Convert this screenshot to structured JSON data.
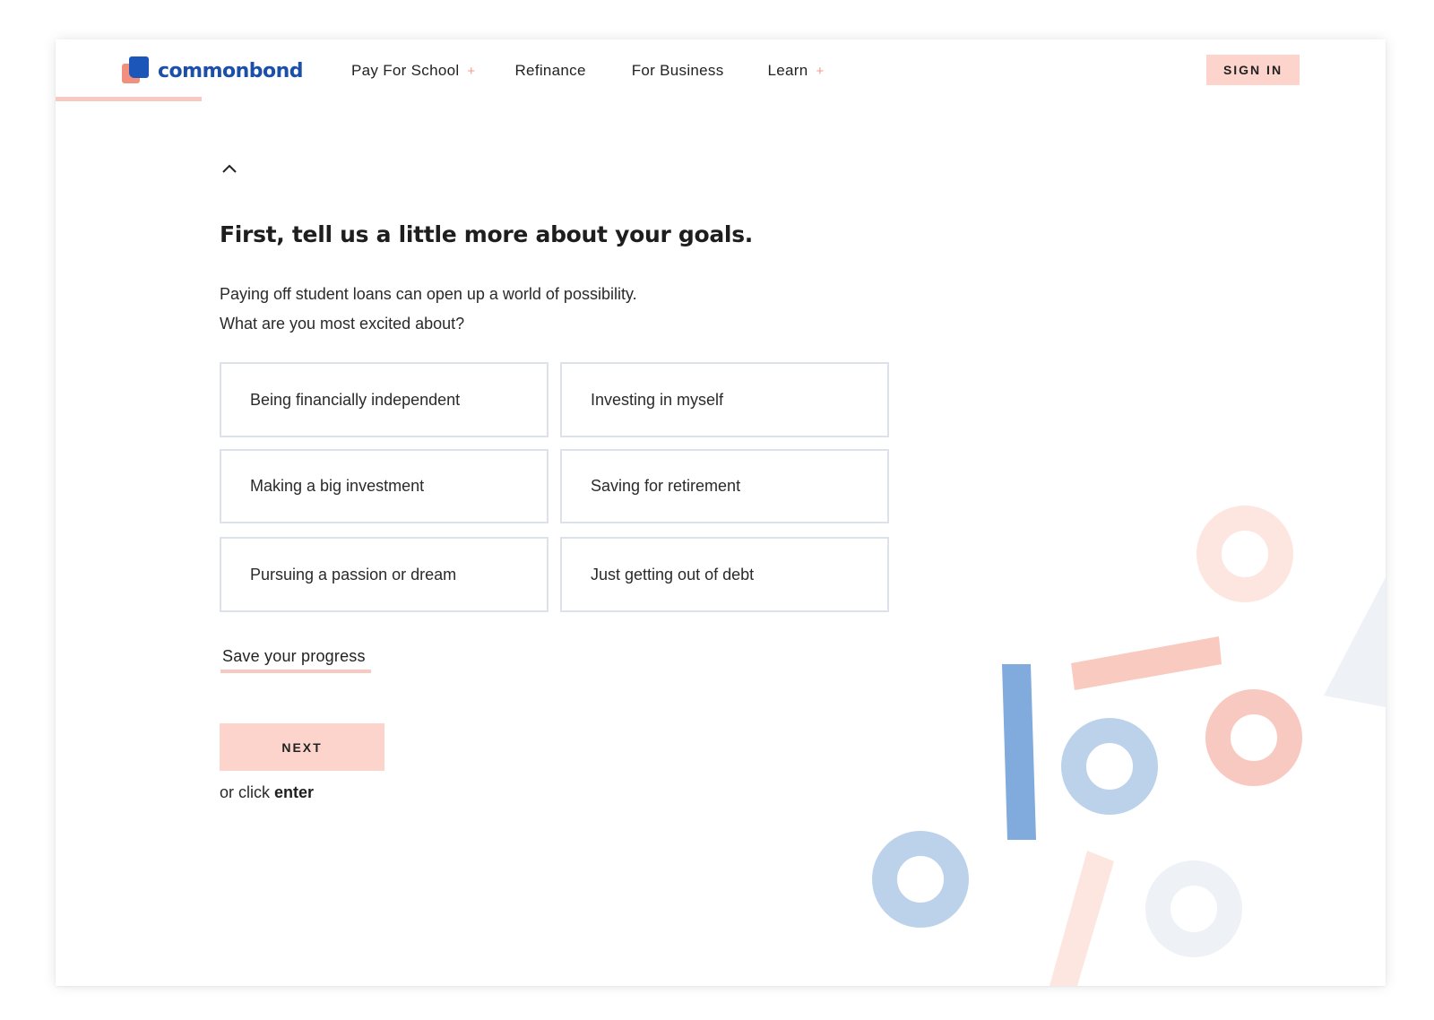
{
  "brand": {
    "name": "commonbond",
    "colors": {
      "blue": "#1b56b8",
      "coral": "#f1907f",
      "pink": "#fcd4cc",
      "light_blue": "#b9cfe8",
      "mid_blue": "#80abdc"
    }
  },
  "progress": {
    "fraction": 0.11
  },
  "nav": {
    "items": [
      {
        "label": "Pay For School",
        "has_submenu": true
      },
      {
        "label": "Refinance",
        "has_submenu": false
      },
      {
        "label": "For Business",
        "has_submenu": false
      },
      {
        "label": "Learn",
        "has_submenu": true
      }
    ],
    "submenu_marker": "+",
    "sign_in_label": "SIGN IN"
  },
  "icons": {
    "back": "chevron-up-icon"
  },
  "form": {
    "title": "First, tell us a little more about your goals.",
    "subtitle_line1": "Paying off student loans can open up a world of possibility.",
    "subtitle_line2": "What are you most excited about?",
    "options": [
      "Being financially independent",
      "Investing in myself",
      "Making a big investment",
      "Saving for retirement",
      "Pursuing a passion or dream",
      "Just getting out of debt"
    ],
    "save_label": "Save your progress",
    "next_label": "NEXT",
    "hint_prefix": "or click",
    "hint_key": "enter"
  }
}
